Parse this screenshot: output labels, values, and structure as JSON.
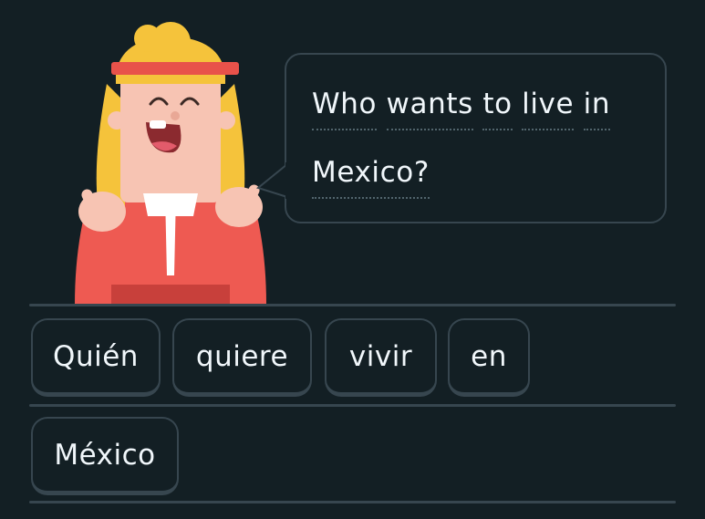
{
  "prompt": {
    "line1_words": [
      "Who",
      "wants",
      "to",
      "live",
      "in"
    ],
    "line2_words": [
      "Mexico?"
    ]
  },
  "word_bank": {
    "tiles": [
      "Quién",
      "quiere",
      "vivir",
      "en",
      "México"
    ]
  },
  "colors": {
    "background": "#131f24",
    "border": "#37464f",
    "text": "#f1f7fb",
    "dotted_underline": "#52656d",
    "character_hair": "#f5c33b",
    "character_headband": "#e8524a",
    "character_skin": "#f7c4b3",
    "character_shirt": "#ee5a52"
  },
  "icons": {
    "character": "lily-character-illustration",
    "speech_bubble": "speech-bubble"
  }
}
